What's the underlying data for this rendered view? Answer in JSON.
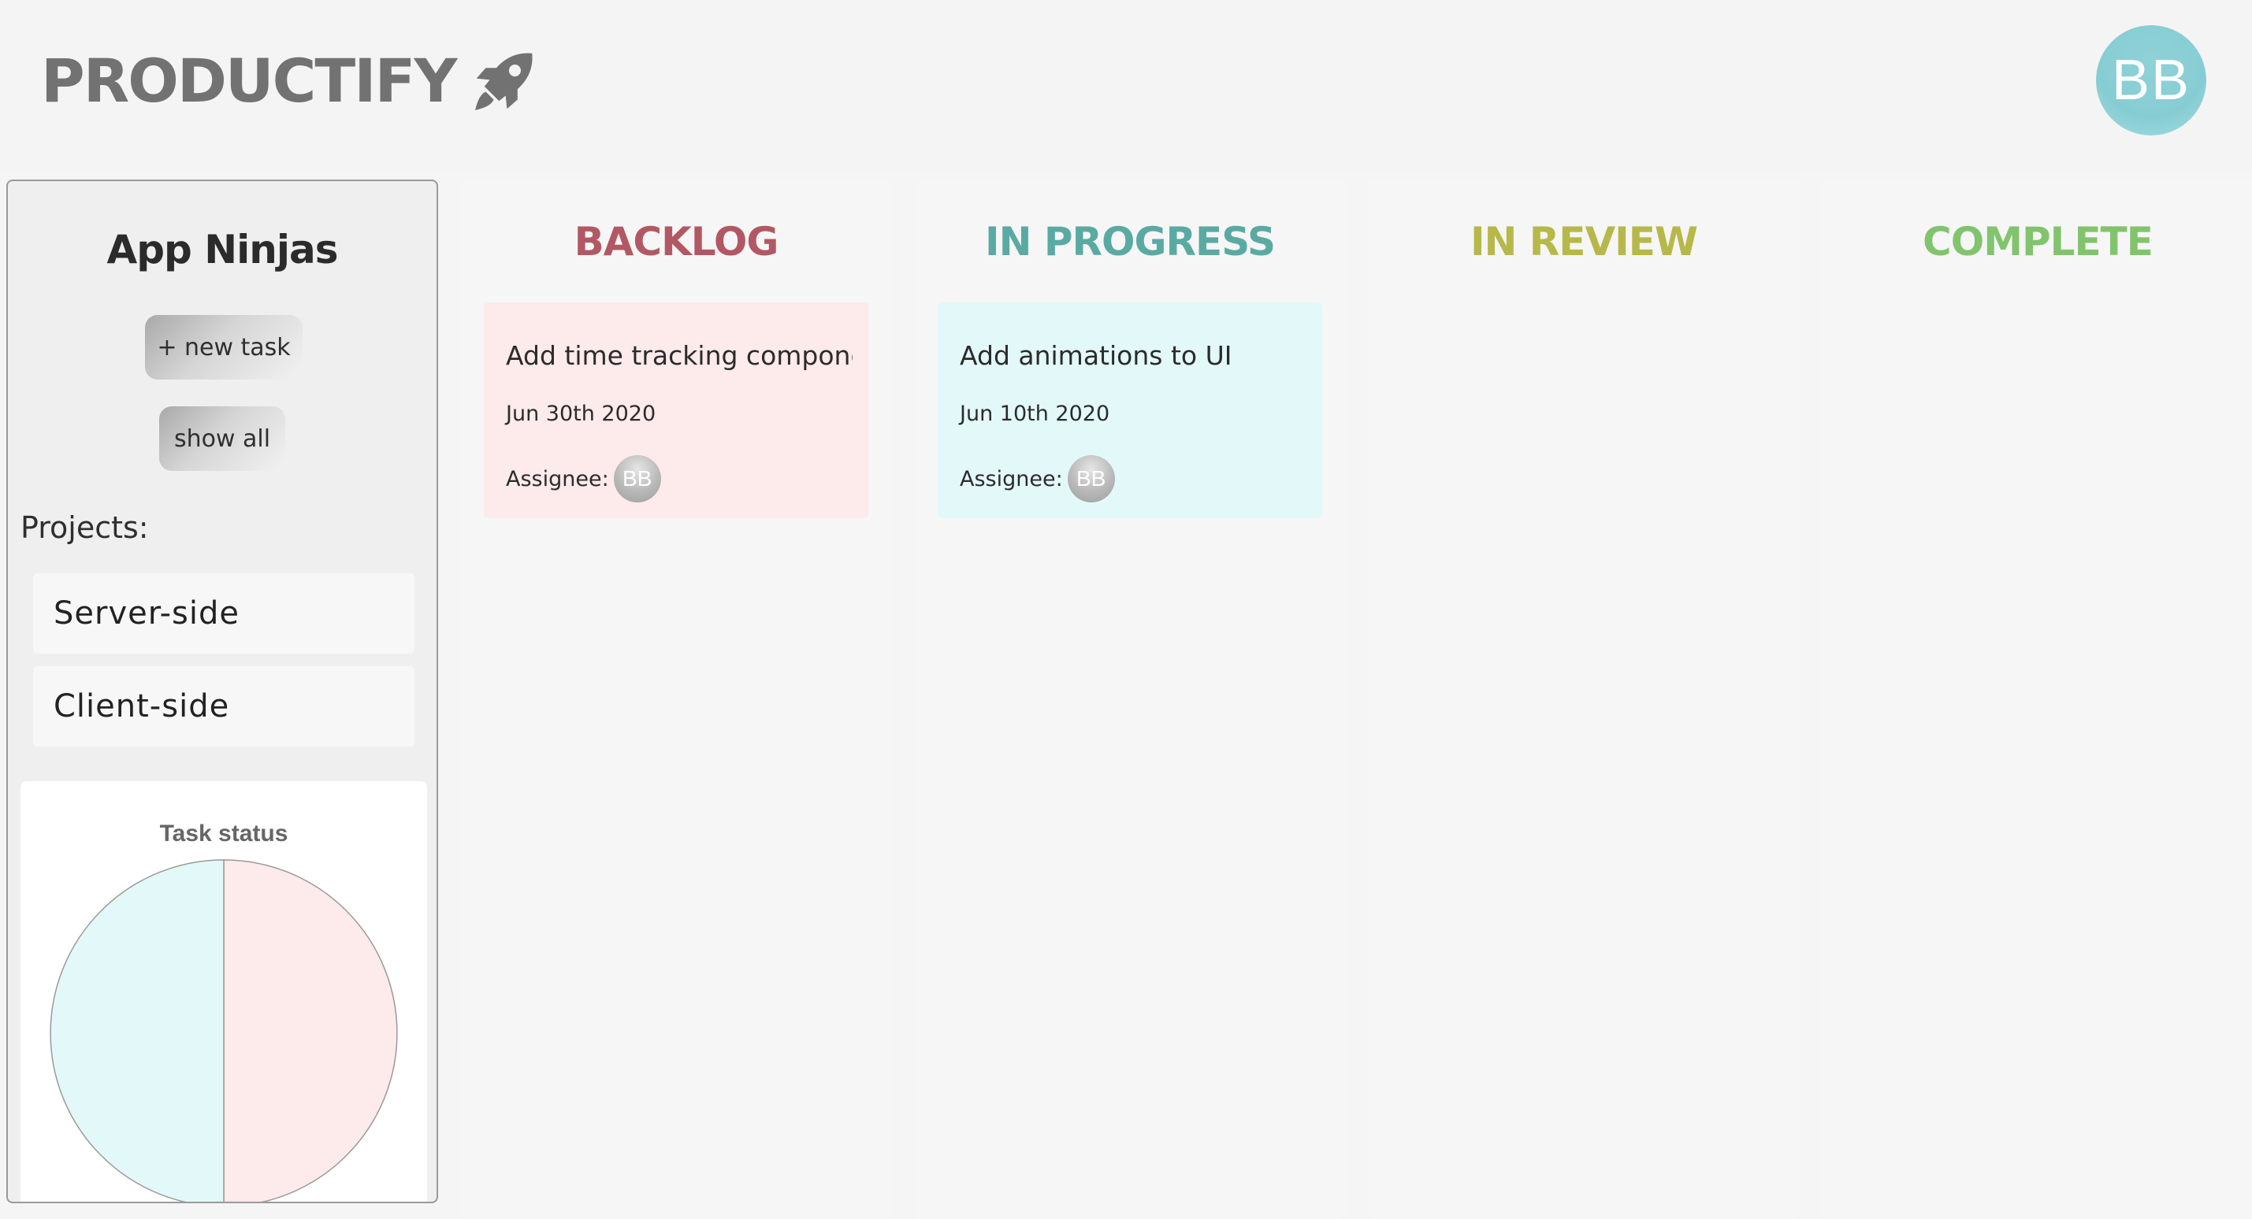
{
  "header": {
    "logo_text": "PRODUCTIFY",
    "logo_icon": "rocket-icon",
    "user_initials": "BB",
    "logo_color": "#727272",
    "avatar_color": "#8fd2d8"
  },
  "sidebar": {
    "team_name": "App Ninjas",
    "new_task_label": "+ new task",
    "show_all_label": "show all",
    "projects_label": "Projects:",
    "projects": [
      {
        "label": "Server-side"
      },
      {
        "label": "Client-side"
      }
    ]
  },
  "chart_data": {
    "type": "pie",
    "title": "Task status",
    "slices": [
      {
        "value": 1,
        "color": "#fdeaea"
      },
      {
        "value": 1,
        "color": "#e3f9f9"
      }
    ]
  },
  "board": {
    "columns": [
      {
        "title": "BACKLOG",
        "color": "#b25864",
        "card_color": "#fdeaea",
        "tasks": [
          {
            "title": "Add time tracking compone...",
            "date": "Jun 30th 2020",
            "assignee_label": "Assignee:",
            "assignee": "BB"
          }
        ]
      },
      {
        "title": "IN PROGRESS",
        "color": "#5aaaa3",
        "card_color": "#e3f9f9",
        "tasks": [
          {
            "title": "Add animations to UI",
            "date": "Jun 10th 2020",
            "assignee_label": "Assignee:",
            "assignee": "BB"
          }
        ]
      },
      {
        "title": "IN REVIEW",
        "color": "#b6b84a",
        "tasks": []
      },
      {
        "title": "COMPLETE",
        "color": "#82c46d",
        "tasks": []
      }
    ]
  }
}
